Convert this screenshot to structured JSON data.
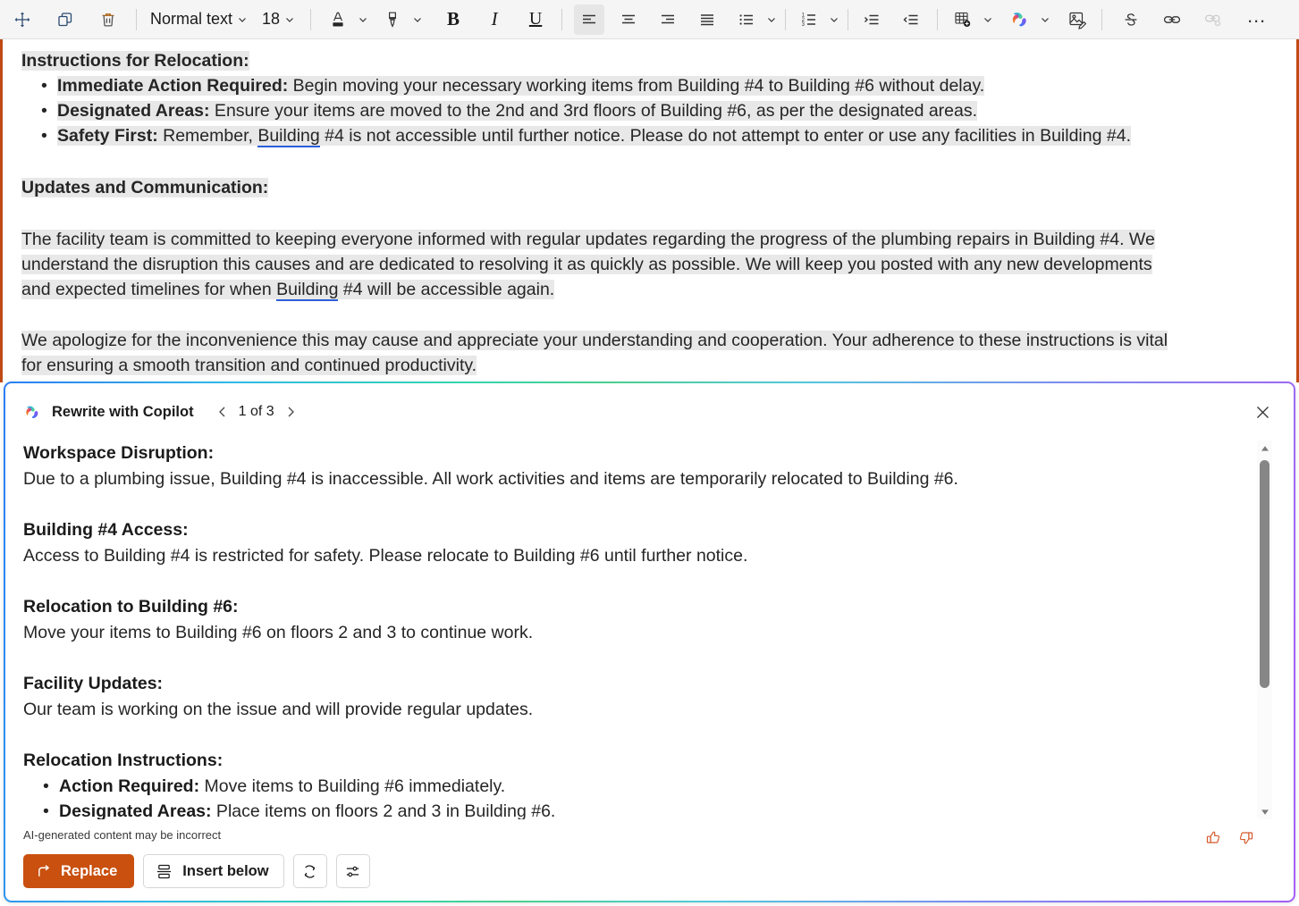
{
  "toolbar": {
    "items": [
      {
        "name": "move-handle-icon",
        "type": "icon",
        "label": "Move"
      },
      {
        "name": "copy-icon",
        "type": "icon",
        "label": "Copy"
      },
      {
        "name": "delete-icon",
        "type": "icon",
        "label": "Delete"
      },
      {
        "name": "paragraph-style-select",
        "type": "select",
        "value": "Normal text"
      },
      {
        "name": "font-size-select",
        "type": "select",
        "value": "18"
      },
      {
        "name": "font-color-icon",
        "type": "icon",
        "label": "Font color"
      },
      {
        "name": "highlight-icon",
        "type": "icon",
        "label": "Text highlight color"
      },
      {
        "name": "bold-button",
        "type": "icon",
        "label": "B"
      },
      {
        "name": "italic-button",
        "type": "icon",
        "label": "I"
      },
      {
        "name": "underline-button",
        "type": "icon",
        "label": "U"
      },
      {
        "name": "align-left-button",
        "type": "icon",
        "label": "Align left"
      },
      {
        "name": "align-center-button",
        "type": "icon",
        "label": "Align center"
      },
      {
        "name": "align-right-button",
        "type": "icon",
        "label": "Align right"
      },
      {
        "name": "align-justify-button",
        "type": "icon",
        "label": "Justify"
      },
      {
        "name": "bulleted-list-button",
        "type": "icon",
        "label": "Bullets"
      },
      {
        "name": "numbered-list-button",
        "type": "icon",
        "label": "Numbering"
      },
      {
        "name": "increase-indent-button",
        "type": "icon",
        "label": "Increase indent"
      },
      {
        "name": "decrease-indent-button",
        "type": "icon",
        "label": "Decrease indent"
      },
      {
        "name": "insert-table-button",
        "type": "icon",
        "label": "Insert table"
      },
      {
        "name": "copilot-icon",
        "type": "icon",
        "label": "Copilot"
      },
      {
        "name": "edit-image-button",
        "type": "icon",
        "label": "Edit image"
      },
      {
        "name": "strikethrough-button",
        "type": "icon",
        "label": "Strikethrough"
      },
      {
        "name": "insert-link-button",
        "type": "icon",
        "label": "Link"
      },
      {
        "name": "remove-link-button",
        "type": "icon",
        "label": "Remove link"
      },
      {
        "name": "more-options-button",
        "type": "icon",
        "label": "More options"
      }
    ],
    "style_value": "Normal text",
    "size_value": "18"
  },
  "document": {
    "heading_1": "Instructions for Relocation:",
    "bullets": [
      {
        "bold": "Immediate Action Required:",
        "text": " Begin moving your necessary working items from Building #4 to Building #6 without delay."
      },
      {
        "bold": "Designated Areas:",
        "text": " Ensure your items are moved to the 2nd and 3rd floors of Building #6, as per the designated areas."
      },
      {
        "bold": "Safety First:",
        "text_a": " Remember, ",
        "flagged": "Building",
        "text_b": " #4 is not accessible until further notice. Please do not attempt to enter or use any facilities in Building #4."
      }
    ],
    "heading_2": "Updates and Communication:",
    "paragraph_1": {
      "line_1": "The facility team is committed to keeping everyone informed with regular updates regarding the progress of the plumbing repairs in Building #4. We",
      "line_2": "understand the disruption this causes and are dedicated to resolving it as quickly as possible. We will keep you posted with any new developments",
      "line_3_a": "and expected timelines for when ",
      "line_3_flagged": "Building",
      "line_3_b": " #4 will be accessible again."
    },
    "paragraph_2": {
      "line_1": "We apologize for the inconvenience this may cause and appreciate your understanding and cooperation. Your adherence to these instructions is vital",
      "line_2": "for ensuring a smooth transition and continued productivity."
    }
  },
  "copilot": {
    "title": "Rewrite with Copilot",
    "counter": "1 of 3",
    "prev_label": "Previous suggestion",
    "next_label": "Next suggestion",
    "close_label": "Close",
    "sections": [
      {
        "heading": "Workspace Disruption:",
        "body": "Due to a plumbing issue, Building #4 is inaccessible. All work activities and items are temporarily relocated to Building #6."
      },
      {
        "heading": "Building #4 Access:",
        "body": "Access to Building #4 is restricted for safety. Please relocate to Building #6 until further notice."
      },
      {
        "heading": "Relocation to Building #6:",
        "body": "Move your items to Building #6 on floors 2 and 3 to continue work."
      },
      {
        "heading": "Facility Updates:",
        "body": "Our team is working on the issue and will provide regular updates."
      }
    ],
    "last_heading": "Relocation Instructions:",
    "last_bullets": [
      {
        "bold": "Action Required:",
        "text": " Move items to Building #6 immediately."
      },
      {
        "bold": "Designated Areas:",
        "text": " Place items on floors 2 and 3 in Building #6."
      }
    ],
    "disclaimer": "AI-generated content may be incorrect",
    "buttons": {
      "replace": "Replace",
      "insert_below": "Insert below",
      "regenerate_label": "Regenerate",
      "settings_label": "Adjust"
    },
    "feedback": {
      "like_label": "Like",
      "dislike_label": "Dislike"
    }
  },
  "colors": {
    "accent_orange": "#c9500f",
    "feedback_orange": "#d4592a",
    "selection_gray": "#e8e8e8",
    "grammar_blue": "#2b5fd9",
    "page_rule": "#c04a16"
  }
}
